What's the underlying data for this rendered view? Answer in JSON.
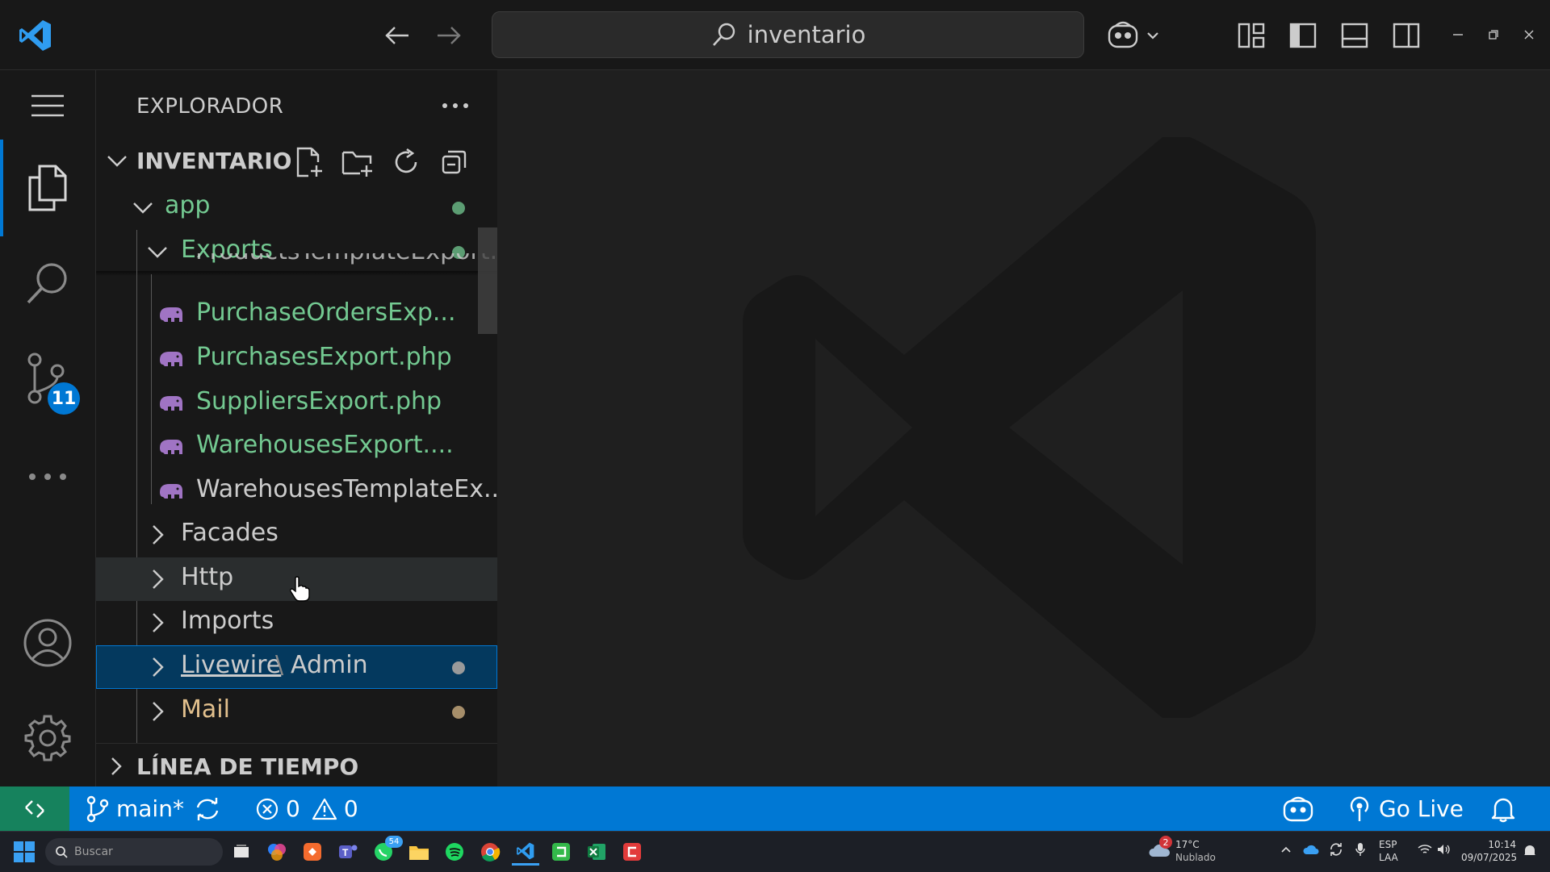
{
  "titlebar": {
    "search_text": "inventario"
  },
  "activitybar": {
    "scm_badge": "11"
  },
  "sidebar": {
    "title": "EXPLORADOR",
    "section_title": "INVENTARIO",
    "tree": {
      "app": "app",
      "exports": "Exports",
      "partial_file": "ProductsTemplateExport...",
      "files": [
        {
          "name": "PurchaseOrdersExp...",
          "status": "U"
        },
        {
          "name": "PurchasesExport.php",
          "status": "U"
        },
        {
          "name": "SuppliersExport.php",
          "status": "U"
        },
        {
          "name": "WarehousesExport....",
          "status": "U"
        },
        {
          "name": "WarehousesTemplateEx...",
          "status": ""
        }
      ],
      "facades": "Facades",
      "http": "Http",
      "imports": "Imports",
      "livewire": "Livewire",
      "livewire_sep": "\\",
      "livewire_sub": "Admin",
      "mail": "Mail"
    },
    "timeline": "LÍNEA DE TIEMPO"
  },
  "statusbar": {
    "branch": "main*",
    "errors": "0",
    "warnings": "0",
    "go_live": "Go Live"
  },
  "taskbar": {
    "search_placeholder": "Buscar",
    "weather_badge": "2",
    "weather_temp": "17°C",
    "weather_desc": "Nublado",
    "lang_1": "ESP",
    "lang_2": "LAA",
    "time": "10:14",
    "date": "09/07/2025",
    "whatsapp_badge": "54"
  },
  "colors": {
    "accent": "#0078d4",
    "untracked": "#73c991",
    "modified": "#e2c08d",
    "remote": "#16825d"
  }
}
